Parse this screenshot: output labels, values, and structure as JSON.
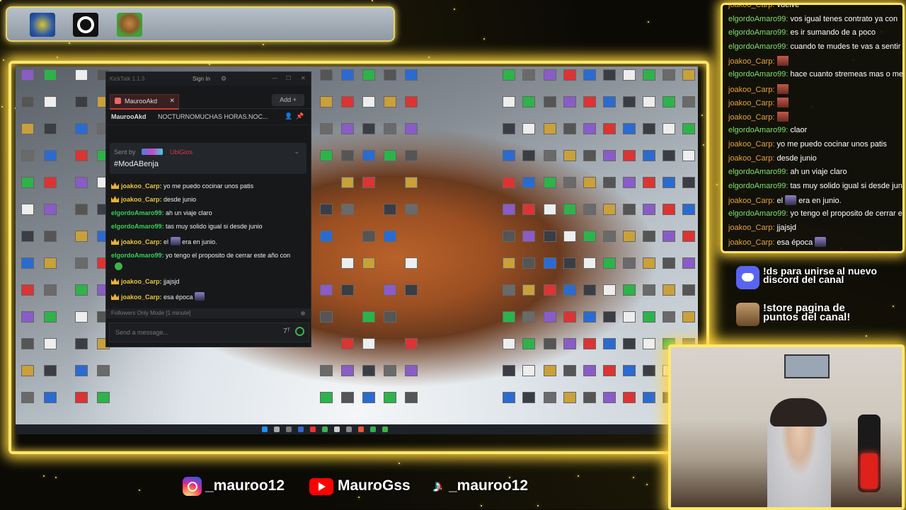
{
  "kicktalk": {
    "title": "KickTalk 1.1.3",
    "signin": "Sign In",
    "tab_label": "MaurooAkd",
    "add_label": "Add",
    "channel": "MaurooAkd",
    "stream_title": "NOCTURNOMUCHAS HORAS.NOC...",
    "pinned_sent_by": "Sent by",
    "pinned_user": "UbiGios",
    "pinned_message": "#ModABenja",
    "messages": [
      {
        "user": "joakoo_Carp",
        "sep": ":",
        "text": "yo me puedo cocinar unos patis",
        "role": "joak"
      },
      {
        "user": "joakoo_Carp",
        "sep": ":",
        "text": "desde junio",
        "role": "joak"
      },
      {
        "user": "elgordoAmaro99",
        "sep": ":",
        "text": "ah un viaje claro",
        "role": "elg"
      },
      {
        "user": "elgordoAmaro99",
        "sep": ":",
        "text": "tas muy solido igual si desde junio",
        "role": "elg"
      },
      {
        "user": "joakoo_Carp",
        "sep": ":",
        "text": "el",
        "text2": "era en junio.",
        "role": "joak"
      },
      {
        "user": "elgordoAmaro99",
        "sep": ":",
        "text": "yo tengo el proposito de cerrar este año con",
        "role": "elg"
      },
      {
        "user": "joakoo_Carp",
        "sep": ":",
        "text": "jjajsjd",
        "role": "joak"
      },
      {
        "user": "joakoo_Carp",
        "sep": ":",
        "text": "esa época",
        "role": "joak"
      }
    ],
    "mode_text": "Followers Only Mode [1 minute]",
    "input_placeholder": "Send a message..."
  },
  "overlay_chat": {
    "messages": [
      {
        "user": "joakoo_Carp",
        "text": "vuelve"
      },
      {
        "user": "elgordoAmaro99",
        "text": "vos igual tenes contrato ya con"
      },
      {
        "user": "elgordoAmaro99",
        "text": "es ir sumando de a poco"
      },
      {
        "user": "elgordoAmaro99",
        "text": "cuando te mudes te vas a sentir"
      },
      {
        "user": "joakoo_Carp",
        "text": ""
      },
      {
        "user": "elgordoAmaro99",
        "text": "hace cuanto stremeas mas o me"
      },
      {
        "user": "joakoo_Carp",
        "text": ""
      },
      {
        "user": "joakoo_Carp",
        "text": ""
      },
      {
        "user": "joakoo_Carp",
        "text": ""
      },
      {
        "user": "elgordoAmaro99",
        "text": "claor"
      },
      {
        "user": "joakoo_Carp",
        "text": "yo me puedo cocinar unos patis"
      },
      {
        "user": "joakoo_Carp",
        "text": "desde junio"
      },
      {
        "user": "elgordoAmaro99",
        "text": "ah un viaje claro"
      },
      {
        "user": "elgordoAmaro99",
        "text": "tas muy solido igual si desde jun"
      },
      {
        "user": "joakoo_Carp",
        "text": "el",
        "text2": "era en junio."
      },
      {
        "user": "elgordoAmaro99",
        "text": "yo tengo el proposito de cerrar e"
      },
      {
        "user": "joakoo_Carp",
        "text": "jjajsjd"
      },
      {
        "user": "joakoo_Carp",
        "text": "esa época"
      }
    ]
  },
  "promos": {
    "discord_text": "!ds para unirse al nuevo discord del canal",
    "discord_line1": "!ds para unirse al nuevo",
    "discord_line2": "discord del canal",
    "store_line1": "!store pagina de",
    "store_line2": "puntos del canal!"
  },
  "socials": {
    "instagram": "_mauroo12",
    "youtube": "MauroGss",
    "tiktok": "_mauroo12"
  },
  "colors": {
    "frame": "#ffe870",
    "joak": "#e9c53c",
    "elg": "#36d156",
    "kick_green": "#3ab54a"
  }
}
